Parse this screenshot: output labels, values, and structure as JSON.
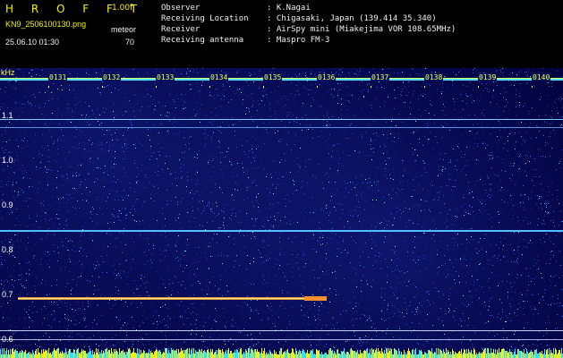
{
  "header": {
    "brand": "H R O F F T",
    "version": "1.00f",
    "filename": "KN9_2506100130.png",
    "mode": "meteor",
    "datetime": "25.06.10 01:30",
    "count": "70",
    "info": [
      {
        "key": "Observer",
        "value": ": K.Nagai"
      },
      {
        "key": "Receiving Location",
        "value": ": Chigasaki, Japan (139.414 35.340)"
      },
      {
        "key": "Receiver",
        "value": ": AirSpy mini (Miakejima VOR 108.65MHz)"
      },
      {
        "key": "Receiving antenna",
        "value": ": Maspro FM-3"
      }
    ]
  },
  "axis": {
    "unit": "kHz",
    "y_labels": [
      "1.1",
      "1.0",
      "0.9",
      "0.8",
      "0.7",
      "0.6"
    ],
    "time_ticks": [
      "0131",
      "0132",
      "0133",
      "0134",
      "0135",
      "0136",
      "0137",
      "0138",
      "0139",
      "0140"
    ]
  },
  "colors": {
    "background": "#00003a",
    "label_yellow": "#f2f200",
    "tone_line": "#60c0ff",
    "noise_low": "#2030c0",
    "noise_high": "#40e0ff"
  }
}
